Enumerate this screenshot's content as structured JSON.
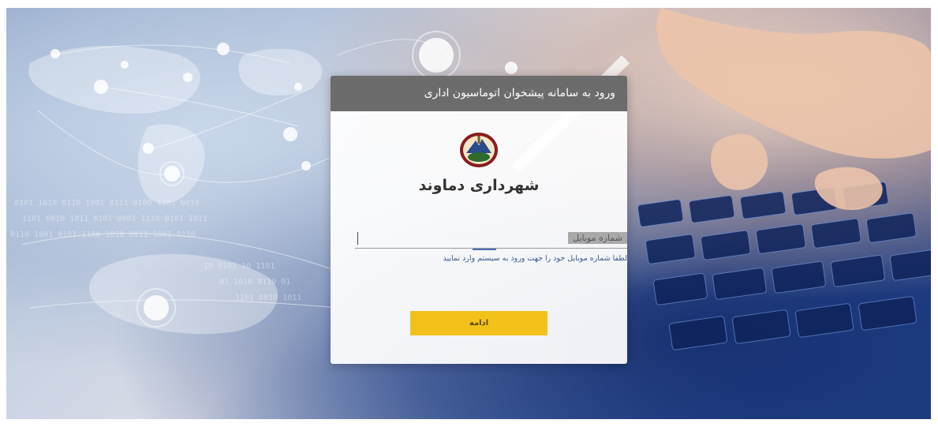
{
  "login": {
    "header_title": "ورود به سامانه پیشخوان اتوماسیون اداری",
    "organization_name": "شهرداری دماوند",
    "mobile_placeholder": "شماره موبایل",
    "mobile_value": "",
    "hint": "لطفا شماره موبایل خود را جهت ورود به سیستم وارد نمایید",
    "continue_label": "ادامه"
  },
  "colors": {
    "header_bg": "#5f5f5f",
    "button_bg": "#f2c21b",
    "hint_text": "#3c5a8a"
  },
  "icons": {
    "logo": "municipality-emblem-icon"
  }
}
